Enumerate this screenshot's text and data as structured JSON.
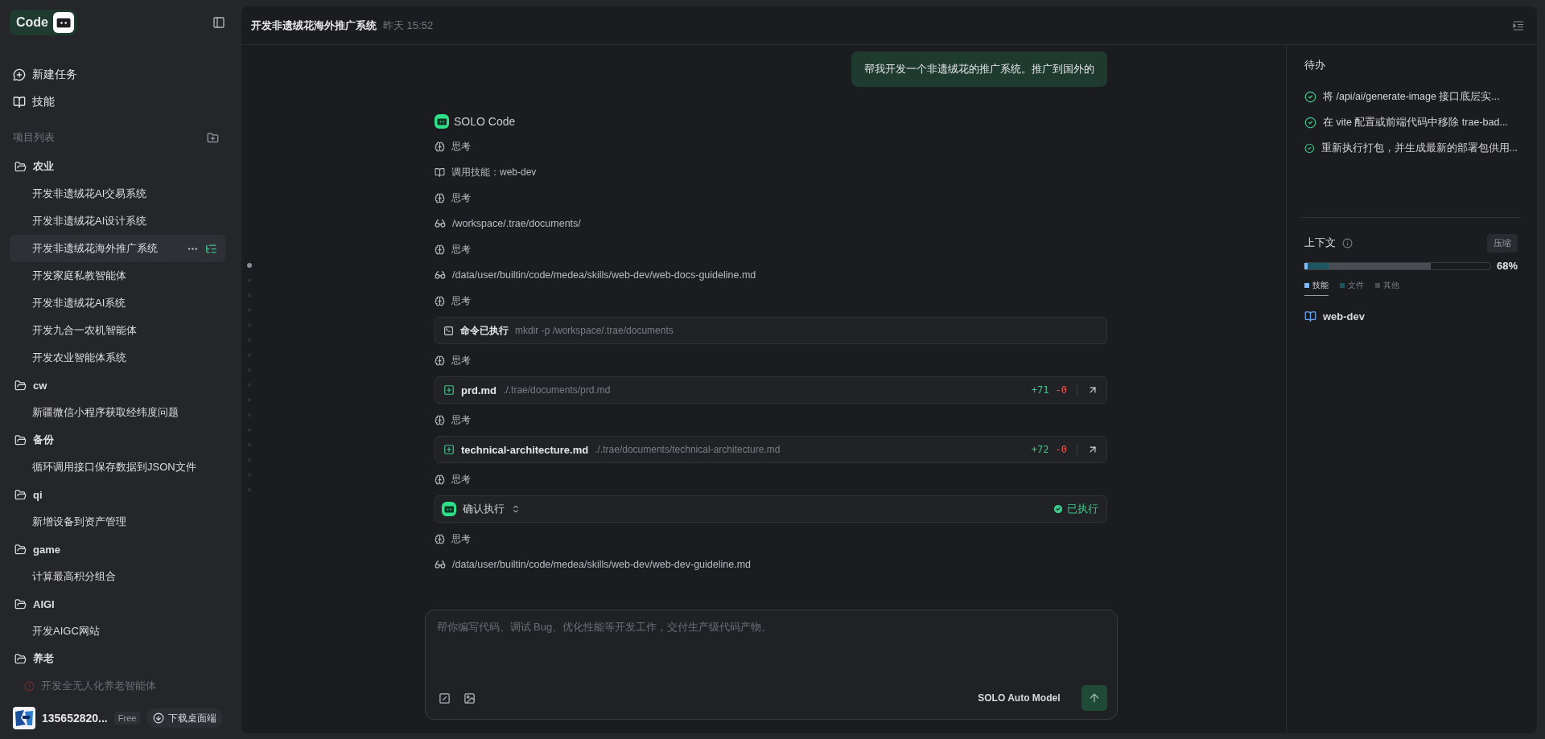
{
  "sidebar": {
    "logo": "Code",
    "nav": [
      {
        "kind": "new",
        "label": "新建任务"
      },
      {
        "kind": "skills",
        "label": "技能"
      }
    ],
    "section_title": "项目列表",
    "groups": [
      {
        "name": "农业",
        "children": [
          {
            "label": "开发非遗绒花AI交易系统",
            "selected": false,
            "failed": false
          },
          {
            "label": "开发非遗绒花AI设计系统",
            "selected": false,
            "failed": false
          },
          {
            "label": "开发非遗绒花海外推广系统",
            "selected": true,
            "failed": false
          },
          {
            "label": "开发家庭私教智能体",
            "selected": false,
            "failed": false
          },
          {
            "label": "开发非遗绒花AI系统",
            "selected": false,
            "failed": false
          },
          {
            "label": "开发九合一农机智能体",
            "selected": false,
            "failed": false
          },
          {
            "label": "开发农业智能体系统",
            "selected": false,
            "failed": false
          }
        ]
      },
      {
        "name": "cw",
        "children": [
          {
            "label": "新疆微信小程序获取经纬度问题",
            "selected": false,
            "failed": false
          }
        ]
      },
      {
        "name": "备份",
        "children": [
          {
            "label": "循环调用接口保存数据到JSON文件",
            "selected": false,
            "failed": false
          }
        ]
      },
      {
        "name": "qi",
        "children": [
          {
            "label": "新增设备到资产管理",
            "selected": false,
            "failed": false
          }
        ]
      },
      {
        "name": "game",
        "children": [
          {
            "label": "计算最高积分组合",
            "selected": false,
            "failed": false
          }
        ]
      },
      {
        "name": "AIGI",
        "children": [
          {
            "label": "开发AIGC网站",
            "selected": false,
            "failed": false
          }
        ]
      },
      {
        "name": "养老",
        "children": [
          {
            "label": "开发全无人化养老智能体",
            "selected": false,
            "failed": true
          }
        ]
      }
    ],
    "user": {
      "name": "135652820...",
      "plan": "Free",
      "download": "下载桌面端"
    }
  },
  "header": {
    "title": "开发非遗绒花海外推广系统",
    "time": "昨天 15:52"
  },
  "chat": {
    "user_message": "帮我开发一个非遗绒花的推广系统。推广到国外的",
    "agent": "SOLO Code",
    "steps": [
      {
        "kind": "think",
        "label": "思考"
      },
      {
        "kind": "skill",
        "label": "调用技能：web-dev"
      },
      {
        "kind": "think",
        "label": "思考"
      },
      {
        "kind": "read",
        "path": "/workspace/.trae/documents/"
      },
      {
        "kind": "think",
        "label": "思考"
      },
      {
        "kind": "read",
        "path": "/data/user/builtin/code/medea/skills/web-dev/web-docs-guideline.md"
      },
      {
        "kind": "think",
        "label": "思考"
      },
      {
        "kind": "command",
        "label": "命令已执行",
        "command": "mkdir -p /workspace/.trae/documents"
      },
      {
        "kind": "think",
        "label": "思考"
      },
      {
        "kind": "file",
        "name": "prd.md",
        "path": "./.trae/documents/prd.md",
        "added": "+71",
        "removed": "-0"
      },
      {
        "kind": "think",
        "label": "思考"
      },
      {
        "kind": "file",
        "name": "technical-architecture.md",
        "path": "./.trae/documents/technical-architecture.md",
        "added": "+72",
        "removed": "-0"
      },
      {
        "kind": "think",
        "label": "思考"
      },
      {
        "kind": "confirm",
        "label": "确认执行",
        "status": "已执行"
      },
      {
        "kind": "think",
        "label": "思考"
      },
      {
        "kind": "read",
        "path": "/data/user/builtin/code/medea/skills/web-dev/web-dev-guideline.md"
      }
    ]
  },
  "input": {
    "placeholder": "帮你编写代码、调试 Bug、优化性能等开发工作，交付生产级代码产物。",
    "model": "SOLO Auto Model"
  },
  "todo": {
    "title": "待办",
    "items": [
      {
        "text": "将 /api/ai/generate-image 接口底层实...",
        "done": true
      },
      {
        "text": "在 vite 配置或前端代码中移除 trae-bad...",
        "done": true
      },
      {
        "text": "重新执行打包，并生成最新的部署包供用...",
        "done": true
      }
    ]
  },
  "context": {
    "title": "上下文",
    "compress": "压缩",
    "percent": "68%",
    "bar": [
      {
        "color": "#7ab8ff",
        "level": 0.018
      },
      {
        "color": "#1d5560",
        "level": 0.131
      },
      {
        "color": "#4b4d55",
        "level": 0.681
      }
    ],
    "legend": [
      {
        "label": "技能",
        "color": "#7ab8ff",
        "selected": true
      },
      {
        "label": "文件",
        "color": "#1d5560",
        "selected": false
      },
      {
        "label": "其他",
        "color": "#4b4d55",
        "selected": false
      }
    ],
    "skills": [
      "web-dev"
    ]
  }
}
